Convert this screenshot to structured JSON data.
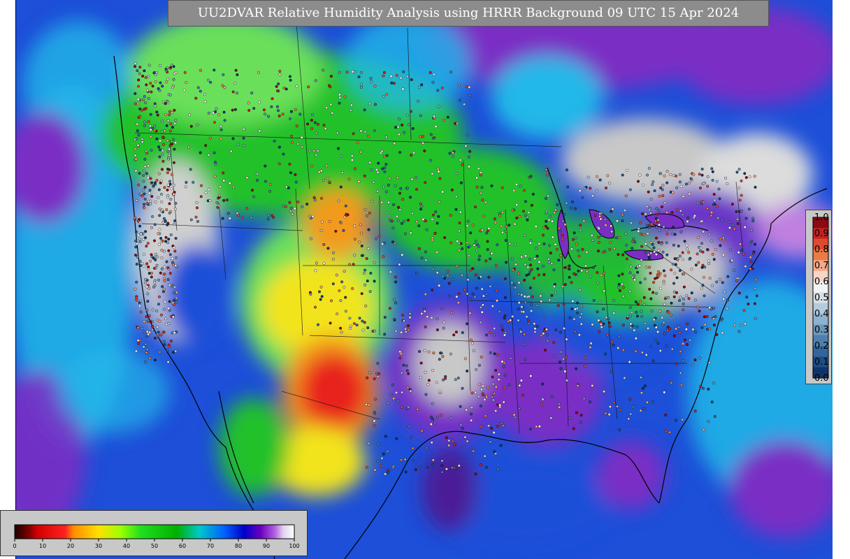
{
  "title": "UU2DVAR Relative Humidity Analysis using HRRR Background 09 UTC 15 Apr 2024",
  "colors": {
    "ocean_blue": "#1d4fd8",
    "cyan": "#22b8e8",
    "green": "#21c12a",
    "light_green": "#6be05a",
    "yellow": "#f2e41b",
    "orange": "#f39a1d",
    "red": "#e8231a",
    "purple": "#7a2fc4",
    "dark_purple": "#4b1a96",
    "gray": "#c8c8c8",
    "magenta": "#c080e0"
  },
  "observation_legend": {
    "labels": [
      "1.0",
      "0.9",
      "0.8",
      "0.7",
      "0.6",
      "0.5",
      "0.4",
      "0.3",
      "0.2",
      "0.1",
      "0.0"
    ],
    "colors": [
      "#8b0a14",
      "#c32222",
      "#de4a2f",
      "#ec7a42",
      "#f4a98a",
      "#f6d5c6",
      "#f2f2f2",
      "#d8dfe5",
      "#b4cbdd",
      "#8db2cf",
      "#6c97bd",
      "#4f7fae",
      "#33679c",
      "#1e4e85",
      "#0e356b"
    ]
  },
  "colorbar": {
    "tick_labels": [
      "0",
      "10",
      "20",
      "30",
      "40",
      "50",
      "60",
      "70",
      "80",
      "90",
      "100"
    ],
    "stops": [
      {
        "v": 0,
        "c": "#1a0000"
      },
      {
        "v": 5,
        "c": "#7a0000"
      },
      {
        "v": 8,
        "c": "#d00000"
      },
      {
        "v": 18,
        "c": "#ff2020"
      },
      {
        "v": 21,
        "c": "#ff8c00"
      },
      {
        "v": 30,
        "c": "#ffe000"
      },
      {
        "v": 38,
        "c": "#9aff00"
      },
      {
        "v": 45,
        "c": "#20e020"
      },
      {
        "v": 58,
        "c": "#00b000"
      },
      {
        "v": 66,
        "c": "#00c8c8"
      },
      {
        "v": 75,
        "c": "#0060ff"
      },
      {
        "v": 82,
        "c": "#0000c8"
      },
      {
        "v": 88,
        "c": "#6a00c0"
      },
      {
        "v": 93,
        "c": "#b060e0"
      },
      {
        "v": 96,
        "c": "#e0d0ee"
      },
      {
        "v": 100,
        "c": "#ffffff"
      }
    ]
  }
}
